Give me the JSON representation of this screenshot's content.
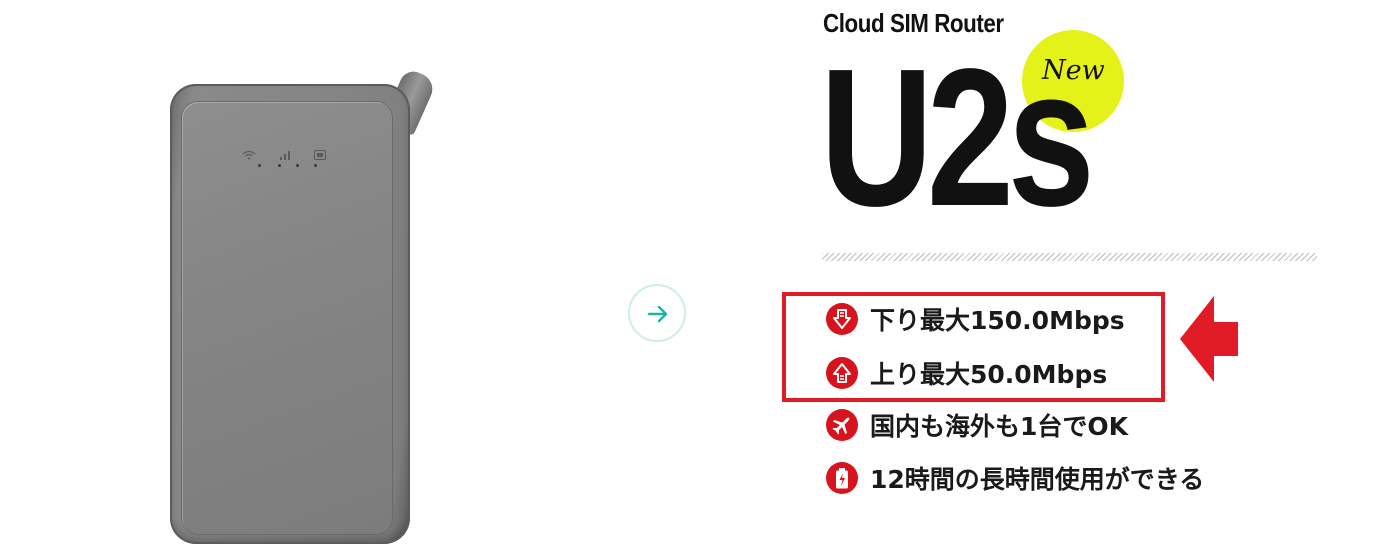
{
  "product": {
    "brand_line": "Cloud SIM Router",
    "model": "U2s",
    "badge": "New"
  },
  "features": [
    {
      "icon": "download-arrow-icon",
      "text": "下り最大150.0Mbps"
    },
    {
      "icon": "upload-arrow-icon",
      "text": "上り最大50.0Mbps"
    },
    {
      "icon": "airplane-icon",
      "text": "国内も海外も1台でOK"
    },
    {
      "icon": "battery-icon",
      "text": "12時間の長時間使用ができる"
    }
  ],
  "colors": {
    "accent_red": "#d7141d",
    "badge_yellow": "#e5f21a",
    "arrow_teal": "#1bb5a8"
  }
}
